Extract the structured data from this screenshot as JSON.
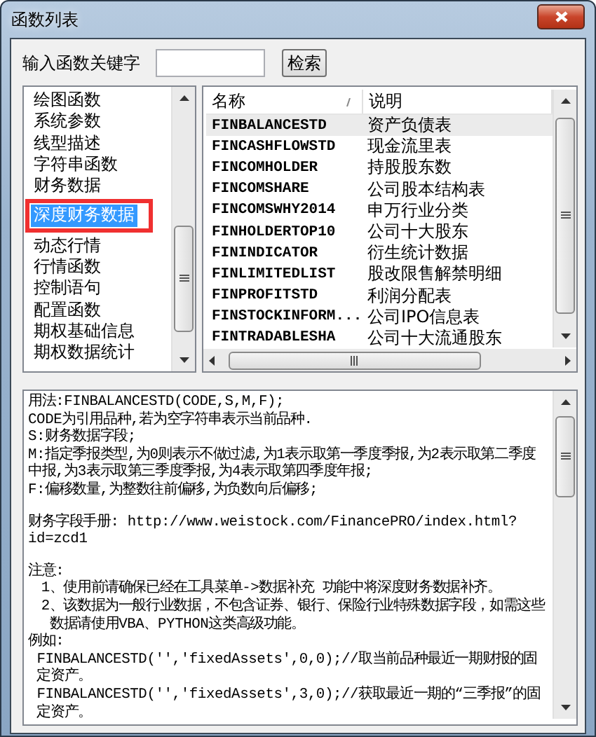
{
  "window": {
    "title": "函数列表"
  },
  "search": {
    "label": "输入函数关键字",
    "button": "检索"
  },
  "categories": [
    {
      "label": "绘图函数",
      "selected": false,
      "highlighted": false
    },
    {
      "label": "系统参数",
      "selected": false,
      "highlighted": false
    },
    {
      "label": "线型描述",
      "selected": false,
      "highlighted": false
    },
    {
      "label": "字符串函数",
      "selected": false,
      "highlighted": false
    },
    {
      "label": "财务数据",
      "selected": false,
      "highlighted": false
    },
    {
      "label": "深度财务数据",
      "selected": true,
      "highlighted": true
    },
    {
      "label": "动态行情",
      "selected": false,
      "highlighted": false
    },
    {
      "label": "行情函数",
      "selected": false,
      "highlighted": false
    },
    {
      "label": "控制语句",
      "selected": false,
      "highlighted": false
    },
    {
      "label": "配置函数",
      "selected": false,
      "highlighted": false
    },
    {
      "label": "期权基础信息",
      "selected": false,
      "highlighted": false
    },
    {
      "label": "期权数据统计",
      "selected": false,
      "highlighted": false
    }
  ],
  "table": {
    "columns": [
      "名称",
      "说明"
    ],
    "rows": [
      {
        "name": "FINBALANCESTD",
        "desc": "资产负债表",
        "selected": true
      },
      {
        "name": "FINCASHFLOWSTD",
        "desc": "现金流里表",
        "selected": false
      },
      {
        "name": "FINCOMHOLDER",
        "desc": "持股股东数",
        "selected": false
      },
      {
        "name": "FINCOMSHARE",
        "desc": "公司股本结构表",
        "selected": false
      },
      {
        "name": "FINCOMSWHY2014",
        "desc": "申万行业分类",
        "selected": false
      },
      {
        "name": "FINHOLDERTOP10",
        "desc": "公司十大股东",
        "selected": false
      },
      {
        "name": "FININDICATOR",
        "desc": "衍生统计数据",
        "selected": false
      },
      {
        "name": "FINLIMITEDLIST",
        "desc": "股改限售解禁明细",
        "selected": false
      },
      {
        "name": "FINPROFITSTD",
        "desc": "利润分配表",
        "selected": false
      },
      {
        "name": "FINSTOCKINFORM...",
        "desc": "公司IPO信息表",
        "selected": false
      },
      {
        "name": "FINTRADABLESHA",
        "desc": "公司十大流通股东",
        "selected": false
      }
    ]
  },
  "help": {
    "usage": [
      "用法:FINBALANCESTD(CODE,S,M,F);",
      "CODE为引用品种,若为空字符串表示当前品种.",
      "S:财务数据字段;",
      "M:指定季报类型,为0则表示不做过滤,为1表示取第一季度季报,为2表示取第二季度中报,为3表示取第三季度季报,为4表示取第四季度年报;",
      "F:偏移数量,为整数往前偏移,为负数向后偏移;"
    ],
    "manual": "财务字段手册: http://www.weistock.com/FinancePRO/index.html?id=zcd1",
    "notes_title": "注意:",
    "notes": [
      "1、使用前请确保已经在工具菜单->数据补充 功能中将深度财务数据补齐。",
      "2、该数据为一般行业数据，不包含证券、银行、保险行业特殊数据字段，如需这些数据请使用VBA、PYTHON这类高级功能。"
    ],
    "examples_title": "例如:",
    "examples": [
      "FINBALANCESTD('','fixedAssets',0,0);//取当前品种最近一期财报的固定资产。",
      "FINBALANCESTD('','fixedAssets',3,0);//获取最近一期的“三季报”的固定资产。"
    ]
  }
}
